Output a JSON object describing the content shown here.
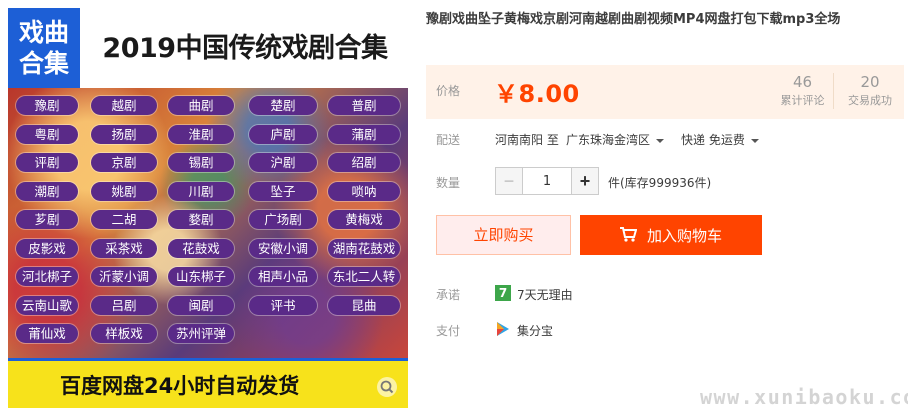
{
  "product_image": {
    "badge_line1": "戏曲",
    "badge_line2": "合集",
    "title": "2019中国传统戏剧合集",
    "genres": [
      "豫剧",
      "越剧",
      "曲剧",
      "楚剧",
      "普剧",
      "粤剧",
      "扬剧",
      "淮剧",
      "庐剧",
      "蒲剧",
      "评剧",
      "京剧",
      "锡剧",
      "沪剧",
      "绍剧",
      "潮剧",
      "姚剧",
      "川剧",
      "坠子",
      "唢呐",
      "芗剧",
      "二胡",
      "婺剧",
      "广场剧",
      "黄梅戏",
      "皮影戏",
      "采茶戏",
      "花鼓戏",
      "安徽小调",
      "湖南花鼓戏",
      "河北梆子",
      "沂蒙小调",
      "山东梆子",
      "相声小品",
      "东北二人转",
      "云南山歌",
      "吕剧",
      "闽剧",
      "评书",
      "昆曲",
      "莆仙戏",
      "样板戏",
      "苏州评弹"
    ],
    "footer": "百度网盘24小时自动发货",
    "zoom_icon": "search-icon"
  },
  "product": {
    "title": "豫剧戏曲坠子黄梅戏京剧河南越剧曲剧视频MP4网盘打包下载mp3全场",
    "price_label": "价格",
    "price": "￥8.00",
    "reviews_count": "46",
    "reviews_label": "累计评论",
    "deals_count": "20",
    "deals_label": "交易成功"
  },
  "shipping": {
    "label": "配送",
    "origin": "河南南阳 至",
    "destination": "广东珠海金湾区",
    "method": "快递 免运费"
  },
  "quantity": {
    "label": "数量",
    "minus": "−",
    "value": "1",
    "plus": "+",
    "stock": "件(库存999936件)"
  },
  "actions": {
    "buy_now": "立即购买",
    "add_to_cart": "加入购物车",
    "cart_icon": "cart-icon"
  },
  "promise": {
    "label": "承诺",
    "icon_text": "7",
    "text": "7天无理由"
  },
  "payment": {
    "label": "支付",
    "text": "集分宝"
  },
  "watermark": "www.xunibaoku.com",
  "colors": {
    "accent": "#ff4400",
    "price_panel_bg": "#fff2e8",
    "tag_purple": "#5a2a88",
    "badge_blue": "#1d5fd6",
    "footer_yellow": "#f7e21b"
  }
}
